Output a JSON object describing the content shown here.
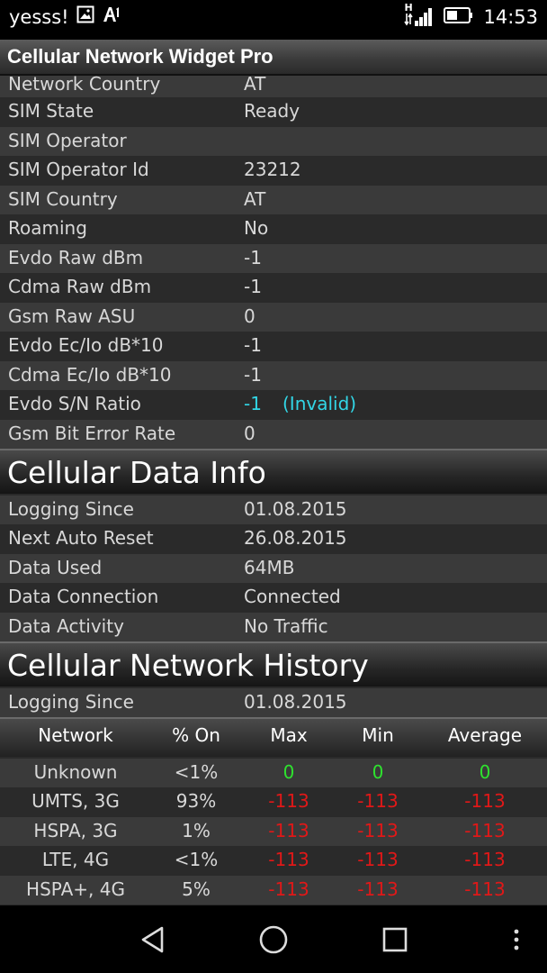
{
  "status_bar": {
    "carrier": "yesss!",
    "net_type": "H",
    "time": "14:53"
  },
  "app": {
    "title": "Cellular Network Widget Pro"
  },
  "sim_info": [
    {
      "label": "Network Country",
      "value": "AT"
    },
    {
      "label": "SIM State",
      "value": "Ready"
    },
    {
      "label": "SIM Operator",
      "value": ""
    },
    {
      "label": "SIM Operator Id",
      "value": "23212"
    },
    {
      "label": "SIM Country",
      "value": "AT"
    },
    {
      "label": "Roaming",
      "value": "No"
    },
    {
      "label": "Evdo Raw dBm",
      "value": "-1"
    },
    {
      "label": "Cdma Raw dBm",
      "value": "-1"
    },
    {
      "label": "Gsm Raw ASU",
      "value": "0"
    },
    {
      "label": "Evdo Ec/Io dB*10",
      "value": "-1"
    },
    {
      "label": "Cdma Ec/Io dB*10",
      "value": "-1"
    },
    {
      "label": "Evdo S/N Ratio",
      "value": "-1",
      "note": "(Invalid)"
    },
    {
      "label": "Gsm Bit Error Rate",
      "value": "0"
    }
  ],
  "data_info": {
    "title": "Cellular Data Info",
    "rows": [
      {
        "label": "Logging Since",
        "value": "01.08.2015"
      },
      {
        "label": "Next Auto Reset",
        "value": "26.08.2015"
      },
      {
        "label": "Data Used",
        "value": "64MB"
      },
      {
        "label": "Data Connection",
        "value": "Connected"
      },
      {
        "label": "Data Activity",
        "value": "No Traffic"
      }
    ]
  },
  "history": {
    "title": "Cellular Network History",
    "logging_label": "Logging Since",
    "logging_value": "01.08.2015",
    "columns": [
      "Network",
      "% On",
      "Max",
      "Min",
      "Average"
    ],
    "rows": [
      {
        "network": "Unknown",
        "pct": "<1%",
        "max": "0",
        "min": "0",
        "avg": "0",
        "color": "#2ee22e"
      },
      {
        "network": "UMTS, 3G",
        "pct": "93%",
        "max": "-113",
        "min": "-113",
        "avg": "-113",
        "color": "#e01818"
      },
      {
        "network": "HSPA, 3G",
        "pct": "1%",
        "max": "-113",
        "min": "-113",
        "avg": "-113",
        "color": "#e01818"
      },
      {
        "network": "LTE, 4G",
        "pct": "<1%",
        "max": "-113",
        "min": "-113",
        "avg": "-113",
        "color": "#e01818"
      },
      {
        "network": "HSPA+, 4G",
        "pct": "5%",
        "max": "-113",
        "min": "-113",
        "avg": "-113",
        "color": "#e01818"
      }
    ]
  },
  "colors": {
    "good": "#2ee22e",
    "bad": "#e01818",
    "info": "#32d6e6"
  },
  "nav": {
    "back": "back-icon",
    "home": "home-icon",
    "recents": "recents-icon",
    "menu": "overflow-menu-icon"
  }
}
